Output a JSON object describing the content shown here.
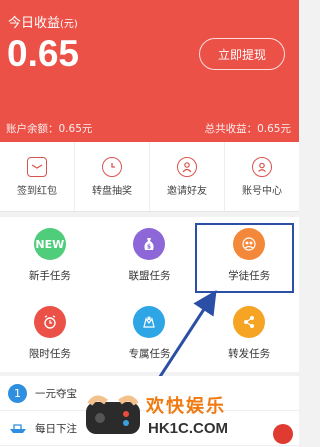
{
  "header": {
    "today_label": "今日收益",
    "today_unit": "(元)",
    "amount": "0.65",
    "withdraw_label": "立即提现",
    "balance_label": "账户余额：0.65元",
    "total_label": "总共收益：0.65元"
  },
  "quickbar": {
    "items": [
      {
        "label": "签到红包",
        "icon": "red-envelope-icon"
      },
      {
        "label": "转盘抽奖",
        "icon": "wheel-icon"
      },
      {
        "label": "邀请好友",
        "icon": "add-friend-icon"
      },
      {
        "label": "账号中心",
        "icon": "account-icon"
      }
    ]
  },
  "grid": {
    "items": [
      {
        "label": "新手任务",
        "icon_text": "NEW",
        "color": "#4fcd7b"
      },
      {
        "label": "联盟任务",
        "icon": "money-bag-icon",
        "color": "#8d66d8"
      },
      {
        "label": "学徒任务",
        "icon": "apprentice-icon",
        "color": "#f4883a"
      },
      {
        "label": "限时任务",
        "icon": "alarm-clock-icon",
        "color": "#ec5148"
      },
      {
        "label": "专属任务",
        "icon": "star-crown-icon",
        "color": "#2ea6e6"
      },
      {
        "label": "转发任务",
        "icon": "share-icon",
        "color": "#f5a423"
      }
    ]
  },
  "list": {
    "items": [
      {
        "badge": "1",
        "label": "一元夺宝"
      },
      {
        "label": "每日下注"
      }
    ]
  },
  "watermark": {
    "title": "欢快娱乐",
    "url": "HK1C.COM"
  }
}
